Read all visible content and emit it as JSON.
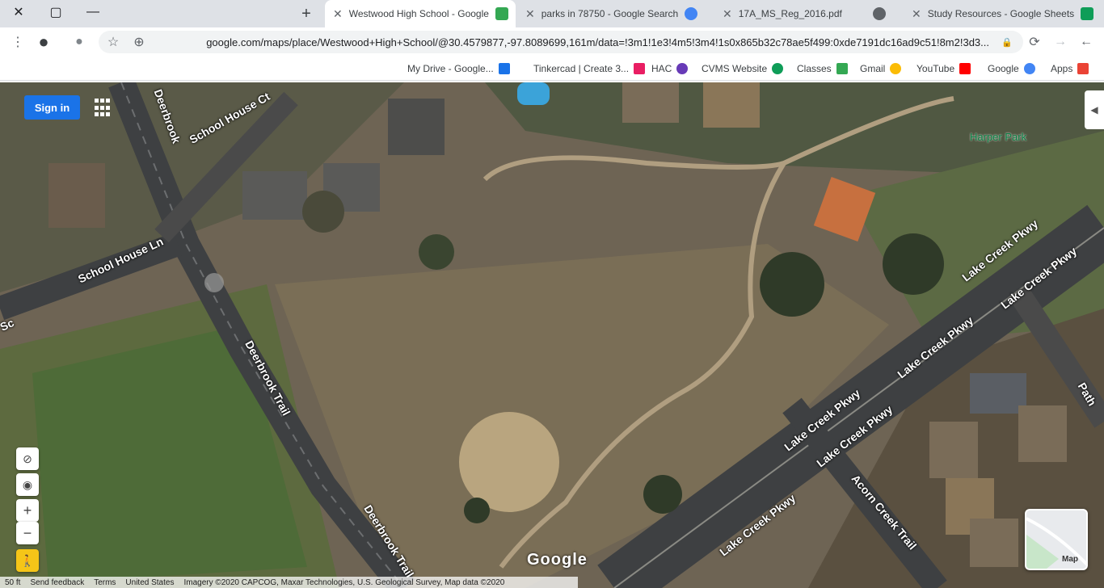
{
  "window": {
    "close_icon": "✕",
    "restore_icon": "▢",
    "minimize_icon": "—"
  },
  "tabs": [
    {
      "label": "Westwood High School - Google",
      "active": true,
      "favicon_color": "#34a853"
    },
    {
      "label": "parks in 78750 - Google Search",
      "active": false,
      "favicon_color": "#4285f4"
    },
    {
      "label": "17A_MS_Reg_2016.pdf",
      "active": false,
      "favicon_color": "#5f6368"
    },
    {
      "label": "Study Resources - Google Sheets",
      "active": false,
      "favicon_color": "#0f9d58"
    }
  ],
  "new_tab_label": "+",
  "toolbar": {
    "url": "google.com/maps/place/Westwood+High+School/@30.4579877,-97.8089699,161m/data=!3m1!1e3!4m5!3m4!1s0x865b32c78ae5f499:0xde7191dc16ad9c51!8m2!3d3...",
    "menu_icon": "⋮",
    "profile_icon": "●",
    "bookmark_star": "☆",
    "zoom_icon": "⊕",
    "reload_icon": "⟳",
    "forward_icon": "→",
    "back_icon": "←",
    "lock_icon": "🔒"
  },
  "bookmarks": [
    {
      "label": "Apps",
      "color": "#ea4335"
    },
    {
      "label": "Google",
      "color": "#4285f4"
    },
    {
      "label": "YouTube",
      "color": "#ff0000"
    },
    {
      "label": "Gmail",
      "color": "#fbbc05"
    },
    {
      "label": "Classes",
      "color": "#34a853"
    },
    {
      "label": "CVMS Website",
      "color": "#0f9d58"
    },
    {
      "label": "HAC",
      "color": "#673ab7"
    },
    {
      "label": "Tinkercad | Create 3...",
      "color": "#e91e63"
    },
    {
      "label": "My Drive - Google...",
      "color": "#1a73e8"
    }
  ],
  "map": {
    "signin_label": "Sign in",
    "park_label": "Harper Park",
    "roads": [
      {
        "label": "Deerbrook"
      },
      {
        "label": "School House Ct"
      },
      {
        "label": "School House Ln"
      },
      {
        "label": "Deerbrook Trail"
      },
      {
        "label": "Deerbrook Trail"
      },
      {
        "label": "Lake Creek Pkwy"
      },
      {
        "label": "Lake Creek Pkwy"
      },
      {
        "label": "Lake Creek Pkwy"
      },
      {
        "label": "Lake Creek Pkwy"
      },
      {
        "label": "Lake Creek Pkwy"
      },
      {
        "label": "Lake Creek Pkwy"
      },
      {
        "label": "Acorn Creek Trail"
      },
      {
        "label": "Path"
      },
      {
        "label": "Sc"
      }
    ],
    "google_logo": "Google",
    "minimap_label": "Map",
    "controls": {
      "compass": "⊘",
      "locate": "◉",
      "zoom_in": "+",
      "zoom_out": "−",
      "pegman": "🚶"
    },
    "footer": [
      "Imagery ©2020 CAPCOG, Maxar Technologies, U.S. Geological Survey, Map data ©2020",
      "United States",
      "Terms",
      "Send feedback",
      "50 ft"
    ]
  }
}
